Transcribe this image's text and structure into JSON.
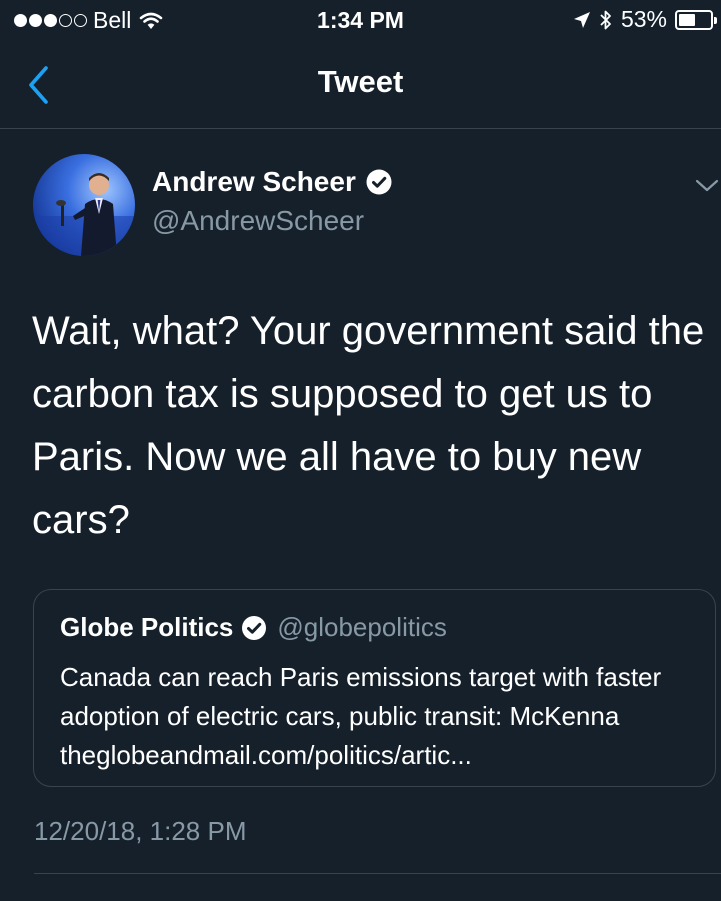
{
  "status_bar": {
    "carrier": "Bell",
    "time": "1:34 PM",
    "battery_percent": "53%",
    "battery_level": 0.53,
    "signal_bars_filled": 3,
    "signal_bars_total": 5,
    "icons": [
      "wifi-icon",
      "location-arrow-icon",
      "bluetooth-icon",
      "battery-icon"
    ]
  },
  "nav": {
    "title": "Tweet",
    "back_icon": "chevron-left-icon"
  },
  "tweet": {
    "author_name": "Andrew Scheer",
    "author_handle": "@AndrewScheer",
    "verified": true,
    "text": "Wait, what? Your government said the carbon tax is supposed to get us to Paris. Now we all have to buy new cars?",
    "timestamp": "12/20/18, 1:28 PM",
    "menu_icon": "chevron-down-icon"
  },
  "quoted_tweet": {
    "author_name": "Globe Politics",
    "author_handle": "@globepolitics",
    "verified": true,
    "text": "Canada can reach Paris emissions target with faster adoption of electric cars, public transit: McKenna theglobeandmail.com/politics/artic..."
  },
  "colors": {
    "background": "#15202b",
    "text_primary": "#ffffff",
    "text_secondary": "#8899a6",
    "accent": "#1da1f2",
    "divider": "#38444d"
  }
}
